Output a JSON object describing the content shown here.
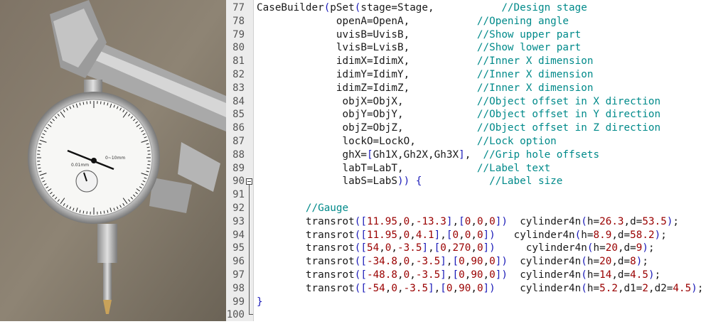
{
  "photo": {
    "caption_words": [
      "0.01mm",
      "0~10mm"
    ]
  },
  "colors": {
    "gutter_bg": "#ececec",
    "line_number": "#555555",
    "plain_text": "#1a1a1a",
    "bracket": "#1a1ab8",
    "number": "#9a0000",
    "comment": "#008a8a"
  },
  "editor": {
    "folded_line": 90,
    "lines": [
      {
        "n": "77",
        "segs": [
          [
            "CaseBuilder",
            "p"
          ],
          [
            "(",
            "b"
          ],
          [
            "pSet",
            "p"
          ],
          [
            "(",
            "b"
          ],
          [
            "stage=Stage,",
            "p"
          ],
          [
            "           ",
            "p"
          ],
          [
            "//Design stage",
            "c"
          ]
        ]
      },
      {
        "n": "78",
        "segs": [
          [
            "             ",
            "p"
          ],
          [
            "openA=OpenA,",
            "p"
          ],
          [
            "           ",
            "p"
          ],
          [
            "//Opening angle",
            "c"
          ]
        ]
      },
      {
        "n": "79",
        "segs": [
          [
            "             ",
            "p"
          ],
          [
            "uvisB=UvisB,",
            "p"
          ],
          [
            "           ",
            "p"
          ],
          [
            "//Show upper part",
            "c"
          ]
        ]
      },
      {
        "n": "80",
        "segs": [
          [
            "             ",
            "p"
          ],
          [
            "lvisB=LvisB,",
            "p"
          ],
          [
            "           ",
            "p"
          ],
          [
            "//Show lower part",
            "c"
          ]
        ]
      },
      {
        "n": "81",
        "segs": [
          [
            "             ",
            "p"
          ],
          [
            "idimX=IdimX,",
            "p"
          ],
          [
            "           ",
            "p"
          ],
          [
            "//Inner X dimension",
            "c"
          ]
        ]
      },
      {
        "n": "82",
        "segs": [
          [
            "             ",
            "p"
          ],
          [
            "idimY=IdimY,",
            "p"
          ],
          [
            "           ",
            "p"
          ],
          [
            "//Inner X dimension",
            "c"
          ]
        ]
      },
      {
        "n": "83",
        "segs": [
          [
            "             ",
            "p"
          ],
          [
            "idimZ=IdimZ,",
            "p"
          ],
          [
            "           ",
            "p"
          ],
          [
            "//Inner X dimension",
            "c"
          ]
        ]
      },
      {
        "n": "84",
        "segs": [
          [
            "              ",
            "p"
          ],
          [
            "objX=ObjX,",
            "p"
          ],
          [
            "            ",
            "p"
          ],
          [
            "//Object offset in X direction",
            "c"
          ]
        ]
      },
      {
        "n": "85",
        "segs": [
          [
            "              ",
            "p"
          ],
          [
            "objY=ObjY,",
            "p"
          ],
          [
            "            ",
            "p"
          ],
          [
            "//Object offset in Y direction",
            "c"
          ]
        ]
      },
      {
        "n": "86",
        "segs": [
          [
            "              ",
            "p"
          ],
          [
            "objZ=ObjZ,",
            "p"
          ],
          [
            "            ",
            "p"
          ],
          [
            "//Object offset in Z direction",
            "c"
          ]
        ]
      },
      {
        "n": "87",
        "segs": [
          [
            "              ",
            "p"
          ],
          [
            "lockO=LockO,",
            "p"
          ],
          [
            "          ",
            "p"
          ],
          [
            "//Lock option",
            "c"
          ]
        ]
      },
      {
        "n": "88",
        "segs": [
          [
            "              ",
            "p"
          ],
          [
            "ghX=",
            "p"
          ],
          [
            "[",
            "b"
          ],
          [
            "Gh1X,Gh2X,Gh3X",
            "p"
          ],
          [
            "]",
            "b"
          ],
          [
            ",",
            "p"
          ],
          [
            "  ",
            "p"
          ],
          [
            "//Grip hole offsets",
            "c"
          ]
        ]
      },
      {
        "n": "89",
        "segs": [
          [
            "              ",
            "p"
          ],
          [
            "labT=LabT,",
            "p"
          ],
          [
            "            ",
            "p"
          ],
          [
            "//Label text",
            "c"
          ]
        ]
      },
      {
        "n": "90",
        "segs": [
          [
            "              ",
            "p"
          ],
          [
            "labS=LabS",
            "p"
          ],
          [
            "))",
            "b"
          ],
          [
            " ",
            "p"
          ],
          [
            "{",
            "b"
          ],
          [
            "           ",
            "p"
          ],
          [
            "//Label size",
            "c"
          ]
        ]
      },
      {
        "n": "91",
        "segs": []
      },
      {
        "n": "92",
        "segs": [
          [
            "        ",
            "p"
          ],
          [
            "//Gauge",
            "c"
          ]
        ]
      },
      {
        "n": "93",
        "segs": [
          [
            "        ",
            "p"
          ],
          [
            "transrot",
            "p"
          ],
          [
            "([",
            "b"
          ],
          [
            "11.95",
            "n"
          ],
          [
            ",",
            "p"
          ],
          [
            "0",
            "n"
          ],
          [
            ",",
            "p"
          ],
          [
            "-13.3",
            "n"
          ],
          [
            "]",
            "b"
          ],
          [
            ",",
            "p"
          ],
          [
            "[",
            "b"
          ],
          [
            "0",
            "n"
          ],
          [
            ",",
            "p"
          ],
          [
            "0",
            "n"
          ],
          [
            ",",
            "p"
          ],
          [
            "0",
            "n"
          ],
          [
            "])",
            "b"
          ],
          [
            "  cylinder4n",
            "p"
          ],
          [
            "(",
            "b"
          ],
          [
            "h=",
            "p"
          ],
          [
            "26.3",
            "n"
          ],
          [
            ",d=",
            "p"
          ],
          [
            "53.5",
            "n"
          ],
          [
            ")",
            "b"
          ],
          [
            ";",
            "p"
          ]
        ]
      },
      {
        "n": "94",
        "segs": [
          [
            "        ",
            "p"
          ],
          [
            "transrot",
            "p"
          ],
          [
            "([",
            "b"
          ],
          [
            "11.95",
            "n"
          ],
          [
            ",",
            "p"
          ],
          [
            "0",
            "n"
          ],
          [
            ",",
            "p"
          ],
          [
            "4.1",
            "n"
          ],
          [
            "]",
            "b"
          ],
          [
            ",",
            "p"
          ],
          [
            "[",
            "b"
          ],
          [
            "0",
            "n"
          ],
          [
            ",",
            "p"
          ],
          [
            "0",
            "n"
          ],
          [
            ",",
            "p"
          ],
          [
            "0",
            "n"
          ],
          [
            "])",
            "b"
          ],
          [
            "   cylinder4n",
            "p"
          ],
          [
            "(",
            "b"
          ],
          [
            "h=",
            "p"
          ],
          [
            "8.9",
            "n"
          ],
          [
            ",d=",
            "p"
          ],
          [
            "58.2",
            "n"
          ],
          [
            ")",
            "b"
          ],
          [
            ";",
            "p"
          ]
        ]
      },
      {
        "n": "95",
        "segs": [
          [
            "        ",
            "p"
          ],
          [
            "transrot",
            "p"
          ],
          [
            "([",
            "b"
          ],
          [
            "54",
            "n"
          ],
          [
            ",",
            "p"
          ],
          [
            "0",
            "n"
          ],
          [
            ",",
            "p"
          ],
          [
            "-3.5",
            "n"
          ],
          [
            "]",
            "b"
          ],
          [
            ",",
            "p"
          ],
          [
            "[",
            "b"
          ],
          [
            "0",
            "n"
          ],
          [
            ",",
            "p"
          ],
          [
            "270",
            "n"
          ],
          [
            ",",
            "p"
          ],
          [
            "0",
            "n"
          ],
          [
            "])",
            "b"
          ],
          [
            "     cylinder4n",
            "p"
          ],
          [
            "(",
            "b"
          ],
          [
            "h=",
            "p"
          ],
          [
            "20",
            "n"
          ],
          [
            ",d=",
            "p"
          ],
          [
            "9",
            "n"
          ],
          [
            ")",
            "b"
          ],
          [
            ";",
            "p"
          ]
        ]
      },
      {
        "n": "96",
        "segs": [
          [
            "        ",
            "p"
          ],
          [
            "transrot",
            "p"
          ],
          [
            "([",
            "b"
          ],
          [
            "-34.8",
            "n"
          ],
          [
            ",",
            "p"
          ],
          [
            "0",
            "n"
          ],
          [
            ",",
            "p"
          ],
          [
            "-3.5",
            "n"
          ],
          [
            "]",
            "b"
          ],
          [
            ",",
            "p"
          ],
          [
            "[",
            "b"
          ],
          [
            "0",
            "n"
          ],
          [
            ",",
            "p"
          ],
          [
            "90",
            "n"
          ],
          [
            ",",
            "p"
          ],
          [
            "0",
            "n"
          ],
          [
            "])",
            "b"
          ],
          [
            "  cylinder4n",
            "p"
          ],
          [
            "(",
            "b"
          ],
          [
            "h=",
            "p"
          ],
          [
            "20",
            "n"
          ],
          [
            ",d=",
            "p"
          ],
          [
            "8",
            "n"
          ],
          [
            ")",
            "b"
          ],
          [
            ";",
            "p"
          ]
        ]
      },
      {
        "n": "97",
        "segs": [
          [
            "        ",
            "p"
          ],
          [
            "transrot",
            "p"
          ],
          [
            "([",
            "b"
          ],
          [
            "-48.8",
            "n"
          ],
          [
            ",",
            "p"
          ],
          [
            "0",
            "n"
          ],
          [
            ",",
            "p"
          ],
          [
            "-3.5",
            "n"
          ],
          [
            "]",
            "b"
          ],
          [
            ",",
            "p"
          ],
          [
            "[",
            "b"
          ],
          [
            "0",
            "n"
          ],
          [
            ",",
            "p"
          ],
          [
            "90",
            "n"
          ],
          [
            ",",
            "p"
          ],
          [
            "0",
            "n"
          ],
          [
            "])",
            "b"
          ],
          [
            "  cylinder4n",
            "p"
          ],
          [
            "(",
            "b"
          ],
          [
            "h=",
            "p"
          ],
          [
            "14",
            "n"
          ],
          [
            ",d=",
            "p"
          ],
          [
            "4.5",
            "n"
          ],
          [
            ")",
            "b"
          ],
          [
            ";",
            "p"
          ]
        ]
      },
      {
        "n": "98",
        "segs": [
          [
            "        ",
            "p"
          ],
          [
            "transrot",
            "p"
          ],
          [
            "([",
            "b"
          ],
          [
            "-54",
            "n"
          ],
          [
            ",",
            "p"
          ],
          [
            "0",
            "n"
          ],
          [
            ",",
            "p"
          ],
          [
            "-3.5",
            "n"
          ],
          [
            "]",
            "b"
          ],
          [
            ",",
            "p"
          ],
          [
            "[",
            "b"
          ],
          [
            "0",
            "n"
          ],
          [
            ",",
            "p"
          ],
          [
            "90",
            "n"
          ],
          [
            ",",
            "p"
          ],
          [
            "0",
            "n"
          ],
          [
            "])",
            "b"
          ],
          [
            "    cylinder4n",
            "p"
          ],
          [
            "(",
            "b"
          ],
          [
            "h=",
            "p"
          ],
          [
            "5.2",
            "n"
          ],
          [
            ",d1=",
            "p"
          ],
          [
            "2",
            "n"
          ],
          [
            ",d2=",
            "p"
          ],
          [
            "4.5",
            "n"
          ],
          [
            ")",
            "b"
          ],
          [
            ";",
            "p"
          ]
        ]
      },
      {
        "n": "99",
        "segs": [
          [
            "}",
            "b"
          ]
        ]
      },
      {
        "n": "100",
        "segs": []
      }
    ]
  }
}
